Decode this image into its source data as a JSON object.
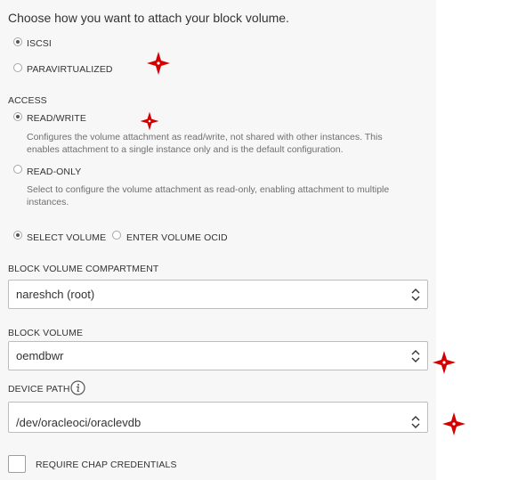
{
  "intro": "Choose how you want to attach your block volume.",
  "attach_type": {
    "options": [
      {
        "label": "ISCSI",
        "selected": true
      },
      {
        "label": "PARAVIRTUALIZED",
        "selected": false
      }
    ]
  },
  "access": {
    "heading": "ACCESS",
    "read_write": {
      "label": "READ/WRITE",
      "selected": true,
      "description_line1": "Configures the volume attachment as read/write, not shared with other instances. This",
      "description_line2": "enables attachment to a single instance only and is the default configuration."
    },
    "read_only": {
      "label": "READ-ONLY",
      "selected": false,
      "description_line1": "Select to configure the volume attachment as read-only, enabling attachment to multiple",
      "description_line2": "instances."
    }
  },
  "volume_mode": {
    "select_volume": {
      "label": "SELECT VOLUME",
      "selected": true
    },
    "enter_ocid": {
      "label": "ENTER VOLUME OCID",
      "selected": false
    }
  },
  "compartment": {
    "label": "BLOCK VOLUME COMPARTMENT",
    "value": "nareshch (root)"
  },
  "block_volume": {
    "label": "BLOCK VOLUME",
    "value": "oemdbwr"
  },
  "device_path": {
    "label": "DEVICE PATH",
    "value": "/dev/oracleoci/oraclevdb",
    "info_icon": "info-icon"
  },
  "chap": {
    "label": "REQUIRE CHAP CREDENTIALS",
    "checked": false
  },
  "colors": {
    "panel_bg": "#f7f7f7",
    "annotation_marker": "#d40000",
    "border": "#bdbdbd"
  }
}
